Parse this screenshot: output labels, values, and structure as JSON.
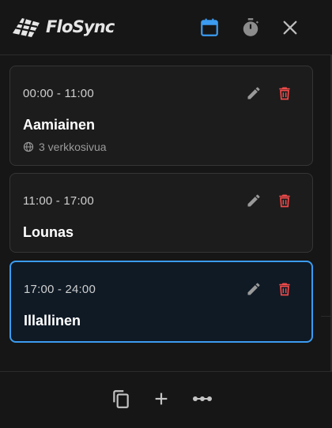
{
  "app": {
    "brand": "FloSync"
  },
  "header": {
    "icons": {
      "calendar": "calendar-icon",
      "timer": "timer-icon",
      "close": "close-icon"
    },
    "active_color": "#3b9cf1"
  },
  "slots": [
    {
      "time": "00:00 - 11:00",
      "name": "Aamiainen",
      "meta": "3 verkkosivua",
      "selected": false
    },
    {
      "time": "11:00 - 17:00",
      "name": "Lounas",
      "selected": false
    },
    {
      "time": "17:00 - 24:00",
      "name": "Illallinen",
      "selected": true
    }
  ],
  "colors": {
    "delete": "#ef4a4a",
    "edit": "#9a9a9a",
    "accent": "#3b9cf1"
  },
  "footer": {
    "icons": {
      "duplicate": "copy-icon",
      "add": "plus-icon",
      "more": "more-icon"
    }
  }
}
